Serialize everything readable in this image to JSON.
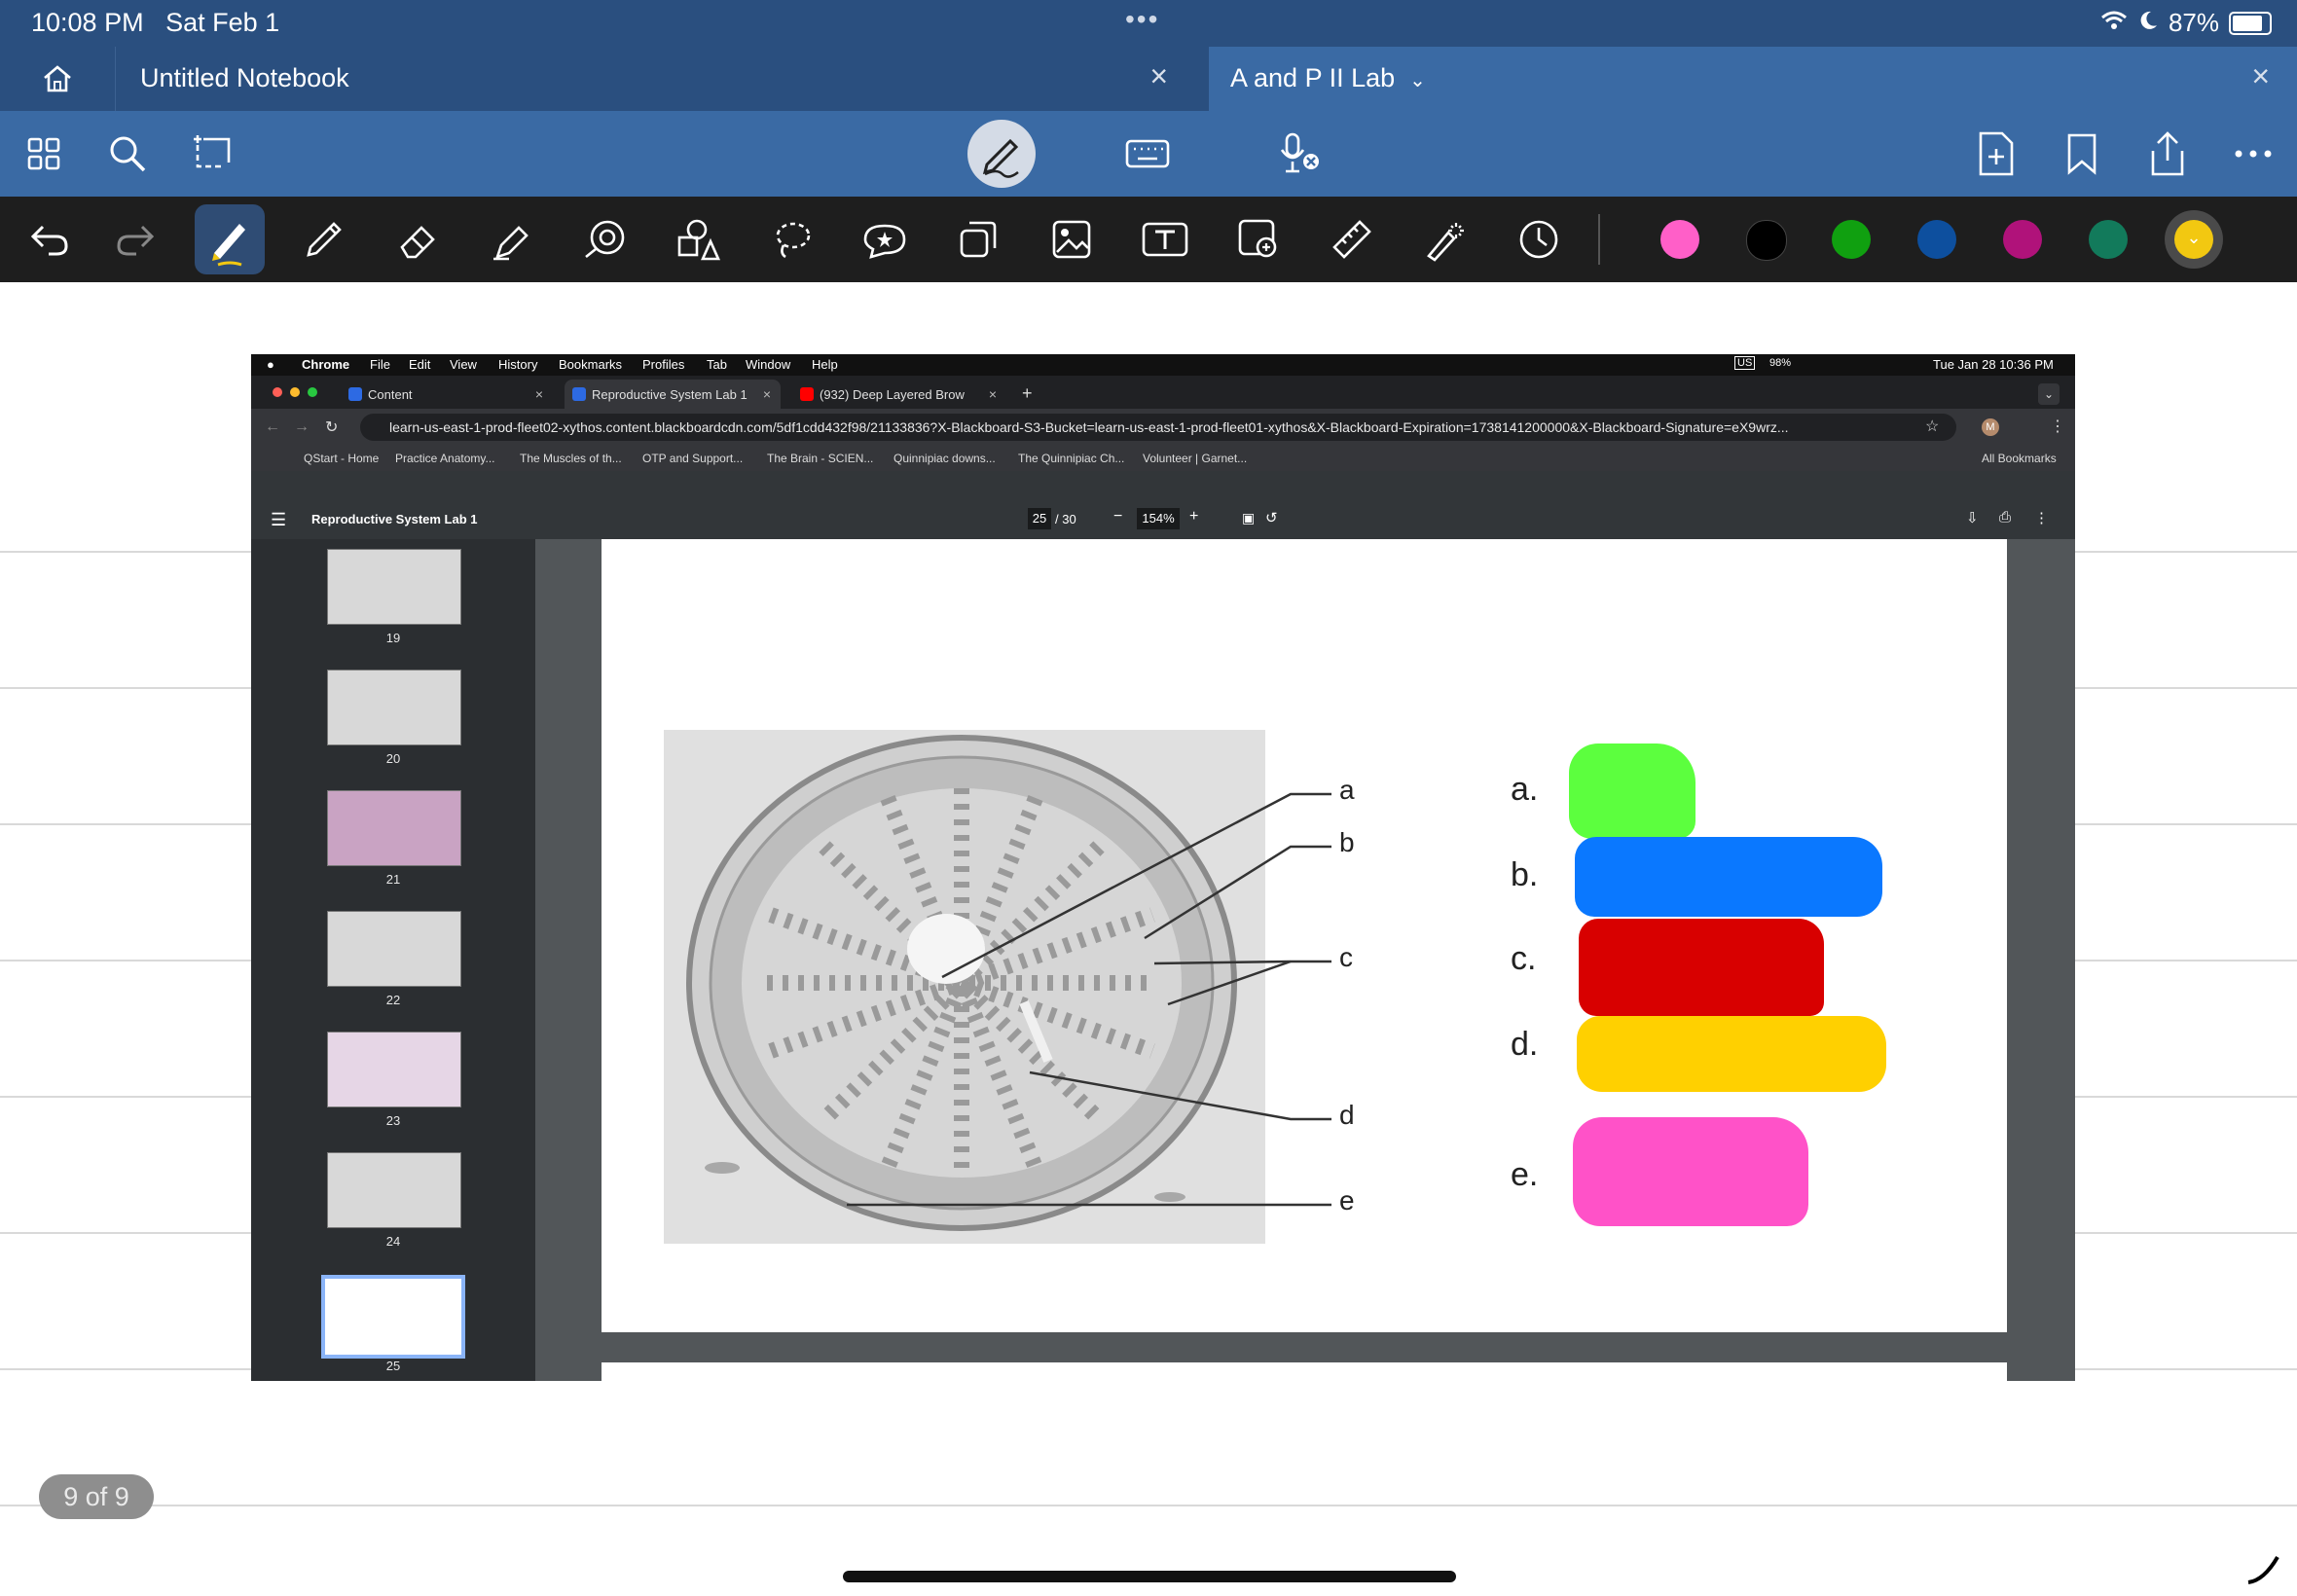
{
  "status_bar": {
    "time": "10:08 PM",
    "date": "Sat Feb 1",
    "battery": "87%"
  },
  "tabs": [
    {
      "label": "Untitled Notebook",
      "close": "×"
    },
    {
      "label": "A and P II Lab",
      "close": "×"
    }
  ],
  "tools": [
    "undo-icon",
    "redo-icon",
    "pen-icon",
    "pencil-icon",
    "eraser-icon",
    "highlighter-icon",
    "shape-icon",
    "elements-icon",
    "lasso-icon",
    "sticker-icon",
    "copy-icon",
    "image-icon",
    "text-icon",
    "camera-icon",
    "ruler-icon",
    "laser-icon",
    "history-icon"
  ],
  "colors": {
    "toolbar_top": "#3a6aa4",
    "toolbar_tools": "#1e1e1e",
    "swatches": [
      "#ff5fc8",
      "#000000",
      "#10a010",
      "#0d4f9e",
      "#b0127a",
      "#127a5b",
      "#f2c811"
    ]
  },
  "page_counter": "9 of 9",
  "screenshot": {
    "menu": {
      "app": "Chrome",
      "items": [
        "File",
        "Edit",
        "View",
        "History",
        "Bookmarks",
        "Profiles",
        "Tab",
        "Window",
        "Help"
      ],
      "battery": "98%",
      "lang": "US",
      "clock": "Tue Jan 28  10:36 PM"
    },
    "browser_tabs": [
      {
        "title": "Content"
      },
      {
        "title": "Reproductive System Lab 1"
      },
      {
        "title": "(932) Deep Layered Brow"
      }
    ],
    "url": "learn-us-east-1-prod-fleet02-xythos.content.blackboardcdn.com/5df1cdd432f98/21133836?X-Blackboard-S3-Bucket=learn-us-east-1-prod-fleet01-xythos&X-Blackboard-Expiration=1738141200000&X-Blackboard-Signature=eX9wrz...",
    "bookmarks": [
      "QStart - Home",
      "Practice Anatomy...",
      "The Muscles of th...",
      "OTP and Support...",
      "The Brain - SCIEN...",
      "Quinnipiac downs...",
      "The Quinnipiac Ch...",
      "Volunteer | Garnet..."
    ],
    "all_bookmarks": "All Bookmarks",
    "pdf": {
      "title": "Reproductive System Lab 1",
      "page": "25",
      "total": "/ 30",
      "zoom": "154%",
      "thumb_pages": [
        "19",
        "20",
        "21",
        "22",
        "23",
        "24",
        "25"
      ],
      "figure_labels": [
        "a",
        "b",
        "c",
        "d",
        "e"
      ],
      "answer_labels": [
        "a.",
        "b.",
        "c.",
        "d.",
        "e."
      ]
    }
  }
}
